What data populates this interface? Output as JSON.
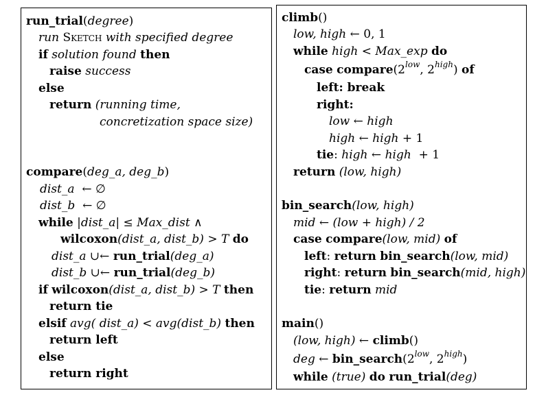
{
  "left": {
    "run_trial": {
      "name": "run_trial",
      "param": "degree",
      "run_word": "run",
      "sketch": "Sketch",
      "with_spec": "with specified degree",
      "if": "if",
      "solution_found": "solution found",
      "then": "then",
      "raise": "raise",
      "success": "success",
      "else": "else",
      "return": "return",
      "ret_a": "(running time,",
      "ret_b": "concretization space size)"
    },
    "compare": {
      "name": "compare",
      "params": "deg_a, deg_b",
      "dist_a": "dist_a",
      "dist_b": "dist_b",
      "assign_empty": "← ∅",
      "while": "while",
      "abs_dist_a": "|dist_a|",
      "le": "≤",
      "max_dist": "Max_dist",
      "and": "∧",
      "wilcoxon": "wilcoxon",
      "wil_args": "(dist_a, dist_b)",
      "gt_T": "> T",
      "do": "do",
      "union_assign": "∪←",
      "run_trial": "run_trial",
      "deg_a_arg": "(deg_a)",
      "deg_b_arg": "(deg_b)",
      "if": "if",
      "then": "then",
      "return": "return",
      "tie": "tie",
      "elsif": "elsif",
      "avg_a": "avg( dist_a)",
      "lt": "<",
      "avg_b": "avg(dist_b)",
      "left": "left",
      "else": "else",
      "right": "right"
    }
  },
  "right": {
    "climb": {
      "name": "climb",
      "parens": "()",
      "init_vars": "low, high",
      "init_assign": "← 0, 1",
      "while": "while",
      "high": "high",
      "lt": "<",
      "max_exp": "Max_exp",
      "do": "do",
      "case": "case",
      "compare": "compare",
      "two": "2",
      "low_exp": "low",
      "high_exp": "high",
      "of": "of",
      "left_label": "left",
      "break": "break",
      "right_label": "right",
      "low": "low",
      "arrow": "←",
      "plus_one": "+ 1",
      "tie_label": "tie",
      "return": "return",
      "ret_pair": "(low, high)"
    },
    "bin_search": {
      "name": "bin_search",
      "params": "(low, high)",
      "mid": "mid",
      "mid_expr": "← (low + high) / 2",
      "case": "case",
      "compare": "compare",
      "cmp_args": "(low, mid)",
      "of": "of",
      "left_label": "left",
      "right_label": "right",
      "tie_label": "tie",
      "return": "return",
      "left_args": "(low, mid)",
      "right_args": "(mid, high)"
    },
    "main": {
      "name": "main",
      "parens": "()",
      "pair": "(low, high)",
      "arrow": "←",
      "climb": "climb",
      "deg": "deg",
      "bin_search": "bin_search",
      "two": "2",
      "low_exp": "low",
      "high_exp": "high",
      "while": "while",
      "true": "(true)",
      "do": "do",
      "run_trial": "run_trial",
      "deg_arg": "(deg)"
    }
  }
}
